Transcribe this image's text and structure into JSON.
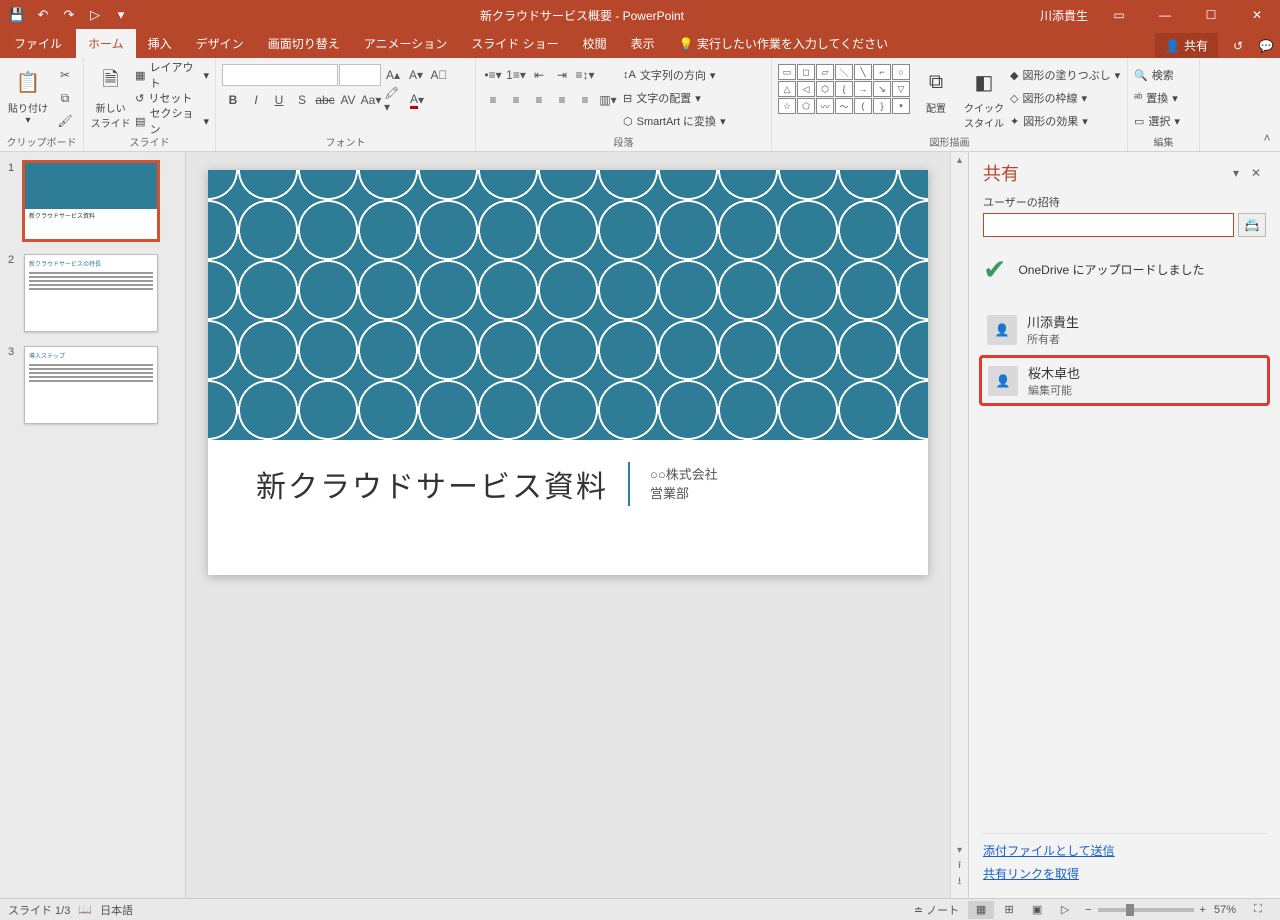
{
  "titlebar": {
    "doc_title": "新クラウドサービス概要  -  PowerPoint",
    "user": "川添貴生"
  },
  "tabs": {
    "file": "ファイル",
    "home": "ホーム",
    "insert": "挿入",
    "design": "デザイン",
    "transitions": "画面切り替え",
    "animations": "アニメーション",
    "slideshow": "スライド ショー",
    "review": "校閲",
    "view": "表示",
    "tellme": "実行したい作業を入力してください",
    "share": "共有"
  },
  "ribbon": {
    "clipboard": {
      "label": "クリップボード",
      "paste": "貼り付け"
    },
    "slides": {
      "label": "スライド",
      "newslide": "新しい\nスライド",
      "layout": "レイアウト",
      "reset": "リセット",
      "section": "セクション"
    },
    "font": {
      "label": "フォント"
    },
    "paragraph": {
      "label": "段落",
      "textdir": "文字列の方向",
      "align": "文字の配置",
      "smartart": "SmartArt に変換"
    },
    "drawing": {
      "label": "図形描画",
      "arrange": "配置",
      "quick": "クイック\nスタイル",
      "fill": "図形の塗りつぶし",
      "outline": "図形の枠線",
      "effects": "図形の効果"
    },
    "editing": {
      "label": "編集",
      "find": "検索",
      "replace": "置換",
      "select": "選択"
    }
  },
  "slide": {
    "title": "新クラウドサービス資料",
    "sub1": "○○株式会社",
    "sub2": "営業部"
  },
  "thumbs": {
    "s2_title": "新クラウドサービスの特長",
    "s3_title": "導入ステップ"
  },
  "share_pane": {
    "title": "共有",
    "invite_label": "ユーザーの招待",
    "status": "OneDrive にアップロードしました",
    "p1_name": "川添貴生",
    "p1_role": "所有者",
    "p2_name": "桜木卓也",
    "p2_role": "編集可能",
    "link1": "添付ファイルとして送信",
    "link2": "共有リンクを取得"
  },
  "status": {
    "slide": "スライド 1/3",
    "lang": "日本語",
    "notes": "ノート",
    "zoom": "57%"
  }
}
